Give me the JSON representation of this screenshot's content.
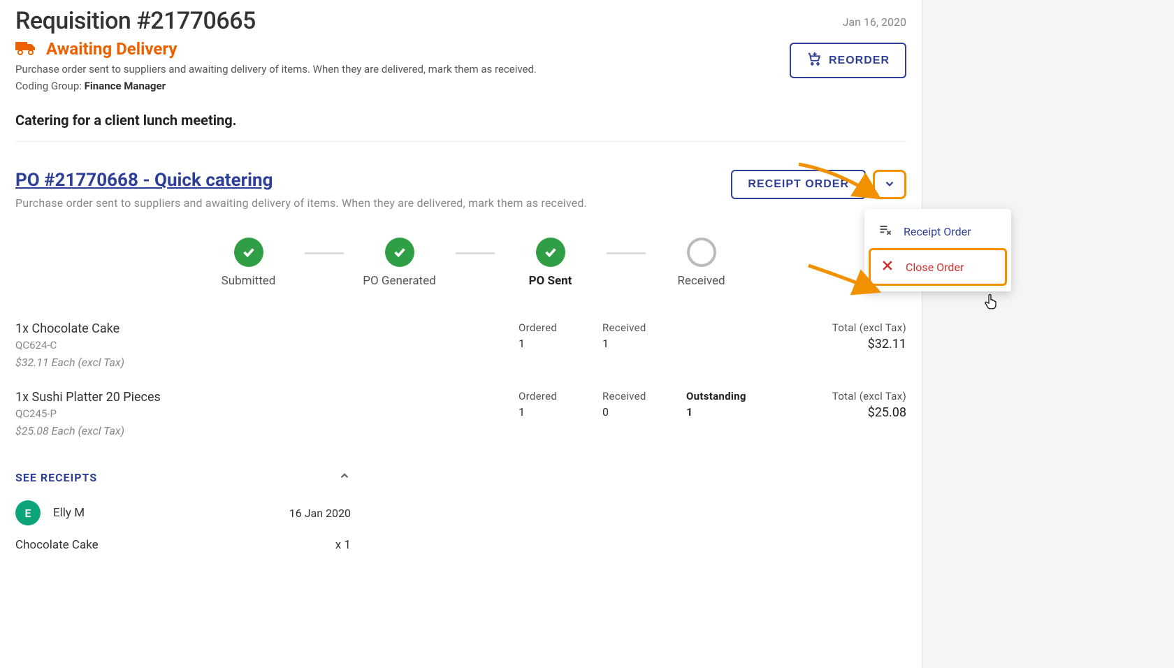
{
  "header": {
    "title": "Requisition #21770665",
    "date": "Jan 16, 2020",
    "status_label": "Awaiting Delivery",
    "status_desc": "Purchase order sent to suppliers and awaiting delivery of items. When they are delivered, mark them as received.",
    "coding_group_label": "Coding Group: ",
    "coding_group_value": "Finance Manager",
    "purpose": "Catering for a client lunch meeting.",
    "reorder_label": "REORDER"
  },
  "po": {
    "link_text": "PO #21770668 - Quick catering",
    "desc": "Purchase order sent to suppliers and awaiting delivery of items. When they are delivered, mark them as received.",
    "receipt_button": "RECEIPT ORDER",
    "menu": {
      "receipt": "Receipt Order",
      "close": "Close Order"
    }
  },
  "steps": [
    {
      "label": "Submitted",
      "state": "done"
    },
    {
      "label": "PO Generated",
      "state": "done"
    },
    {
      "label": "PO Sent",
      "state": "done_current"
    },
    {
      "label": "Received",
      "state": "pending"
    }
  ],
  "labels": {
    "ordered": "Ordered",
    "received": "Received",
    "outstanding": "Outstanding",
    "total_excl": "Total (excl Tax)"
  },
  "items": [
    {
      "name": "1x Chocolate Cake",
      "sku": "QC624-C",
      "price": "$32.11 Each (excl Tax)",
      "ordered": "1",
      "received": "1",
      "outstanding": "",
      "total": "$32.11"
    },
    {
      "name": "1x Sushi Platter 20 Pieces",
      "sku": "QC245-P",
      "price": "$25.08 Each (excl Tax)",
      "ordered": "1",
      "received": "0",
      "outstanding": "1",
      "total": "$25.08"
    }
  ],
  "receipts": {
    "toggle": "SEE RECEIPTS",
    "entry": {
      "avatar_initial": "E",
      "user": "Elly M",
      "date": "16 Jan 2020"
    },
    "line": {
      "item": "Chocolate Cake",
      "qty": "x 1"
    }
  }
}
